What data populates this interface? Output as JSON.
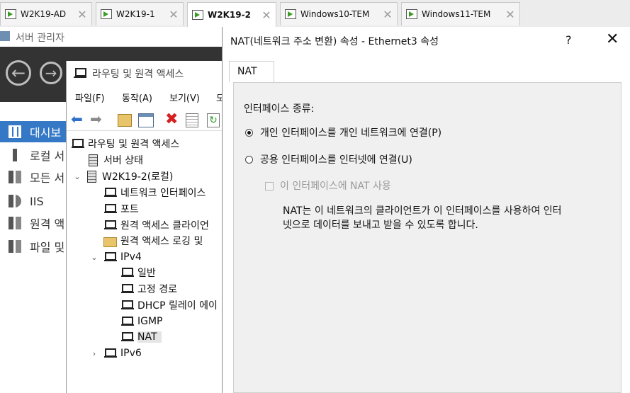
{
  "vm_tabs": [
    {
      "label": "W2K19-AD"
    },
    {
      "label": "W2K19-1"
    },
    {
      "label": "W2K19-2"
    },
    {
      "label": "Windows10-TEM"
    },
    {
      "label": "Windows11-TEM"
    }
  ],
  "active_vm_tab": "W2K19-2",
  "server_manager": {
    "title": "서버 관리자",
    "nav_items": [
      {
        "label": "대시보",
        "icon": "dashboard-icon"
      },
      {
        "label": "로컬 서",
        "icon": "local-server-icon"
      },
      {
        "label": "모든 서",
        "icon": "all-servers-icon"
      },
      {
        "label": "IIS",
        "icon": "iis-icon"
      },
      {
        "label": "원격 액",
        "icon": "remote-access-icon"
      },
      {
        "label": "파일 및",
        "icon": "file-storage-icon"
      }
    ]
  },
  "rras": {
    "title": "라우팅 및 원격 액세스",
    "menu": [
      "파일(F)",
      "동작(A)",
      "보기(V)",
      "도"
    ],
    "tree": {
      "root": "라우팅 및 원격 액세스",
      "server_status": "서버 상태",
      "server": "W2K19-2(로컬)",
      "children": [
        "네트워크 인터페이스",
        "포트",
        "원격 액세스 클라이언",
        "원격 액세스 로깅 및"
      ],
      "ipv4": "IPv4",
      "ipv4_children": [
        "일반",
        "고정 경로",
        "DHCP 릴레이 에이",
        "IGMP",
        "NAT"
      ],
      "ipv6": "IPv6"
    }
  },
  "dialog": {
    "title": "NAT(네트워크 주소 변환) 속성 - Ethernet3 속성",
    "help": "?",
    "close": "✕",
    "tab": "NAT",
    "interface_type_label": "인터페이스 종류:",
    "option_private": "개인 인터페이스를 개인 네트워크에 연결(P)",
    "option_public": "공용 인터페이스를 인터넷에 연결(U)",
    "enable_nat_checkbox": "이 인터페이스에 NAT 사용",
    "description_line1": "NAT는 이 네트워크의 클라이언트가 이 인터페이스를 사용하여 인터",
    "description_line2": "넷으로 데이터를 보내고 받을 수 있도록 합니다.",
    "selected_option": "private",
    "nat_enabled": false
  },
  "colors": {
    "accent_blue": "#3478c6",
    "header_dark": "#333333",
    "vm_play_green": "#3a9d23"
  }
}
